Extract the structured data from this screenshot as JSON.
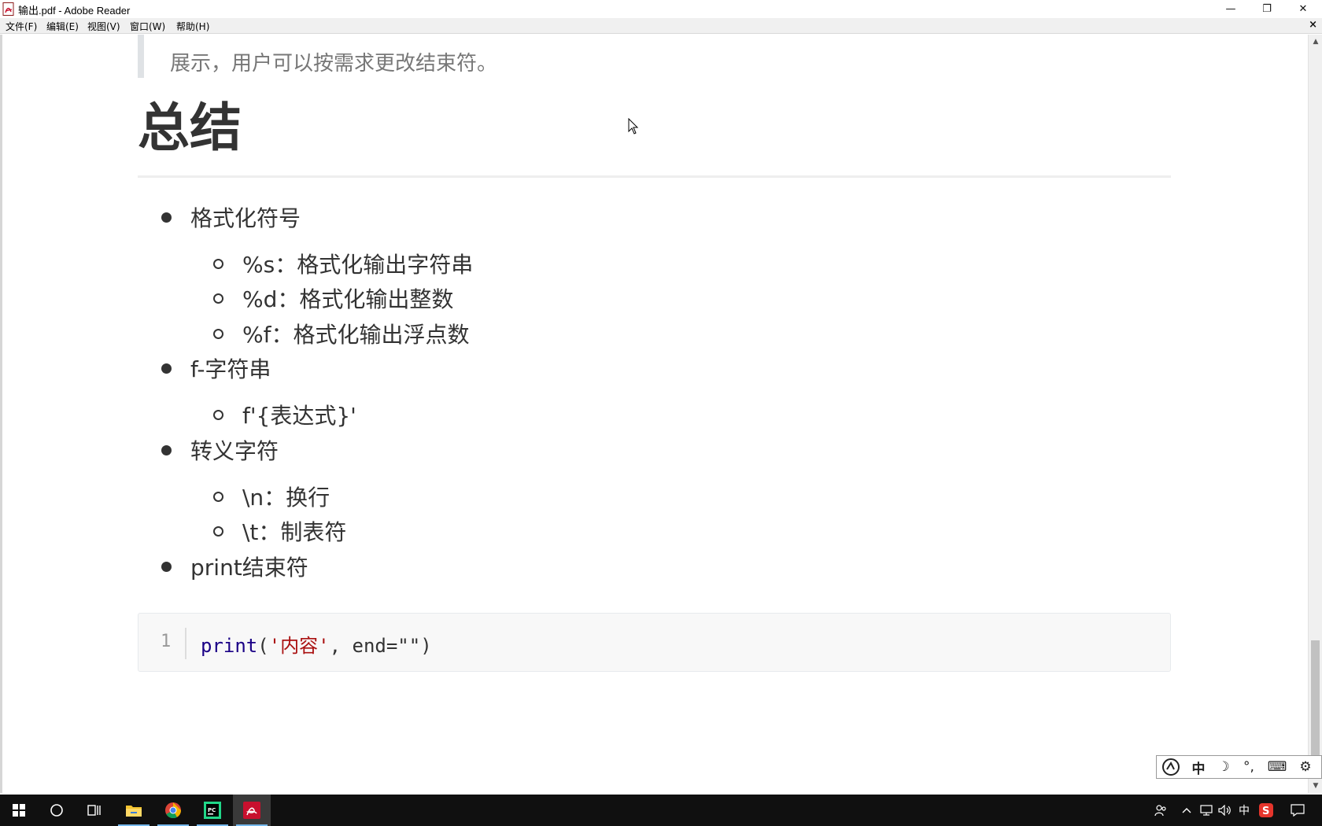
{
  "window": {
    "title": "输出.pdf - Adobe Reader",
    "minimize_glyph": "—",
    "restore_glyph": "❐",
    "close_glyph": "✕"
  },
  "menubar": {
    "items": [
      "文件(F)",
      "编辑(E)",
      "视图(V)",
      "窗口(W)",
      "帮助(H)"
    ],
    "close_doc_glyph": "×"
  },
  "document": {
    "quote_text": "展示，用户可以按需求更改结束符。",
    "heading": "总结",
    "list": [
      {
        "label": "格式化符号",
        "children": [
          "%s：格式化输出字符串",
          "%d：格式化输出整数",
          "%f：格式化输出浮点数"
        ]
      },
      {
        "label": "f-字符串",
        "children": [
          "f'{表达式}'"
        ]
      },
      {
        "label": "转义字符",
        "children": [
          "\\n：换行",
          "\\t：制表符"
        ]
      },
      {
        "label": "print结束符",
        "children": []
      }
    ],
    "code": {
      "line_number": "1",
      "fn": "print",
      "open": "(",
      "str": "'内容'",
      "rest": ", end=\"\")"
    }
  },
  "ime": {
    "items": [
      "中",
      "☽",
      "°,",
      "⌨",
      "⚙"
    ]
  },
  "colors": {
    "taskbar_bg": "#101010",
    "accent": "#76b9ed",
    "heading": "#333333",
    "code_fn": "#1a0086",
    "code_str": "#aa1111"
  },
  "taskbar": {
    "apps": [
      "start-icon",
      "search-icon",
      "task-view-icon",
      "file-explorer-icon",
      "chrome-icon",
      "pycharm-icon",
      "adobe-reader-icon"
    ],
    "tray_lang": "中"
  }
}
